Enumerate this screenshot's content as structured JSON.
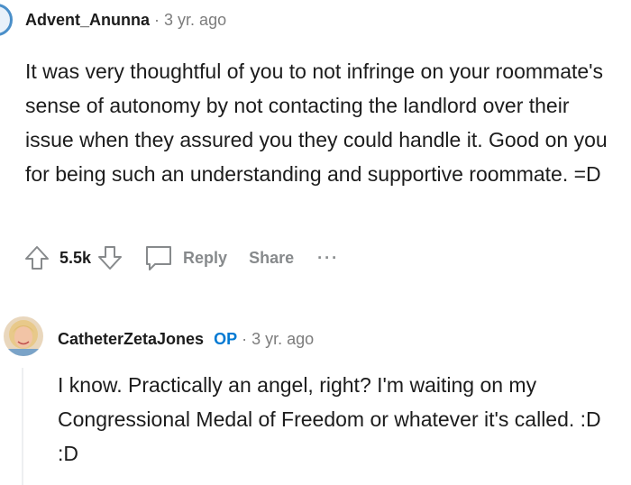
{
  "comments": [
    {
      "username": "Advent_Anunna",
      "separator": "·",
      "time": "3 yr. ago",
      "body": "It was very thoughtful of you to not infringe on your roommate's sense of autonomy by not contacting the landlord over their issue when they assured you they could handle it. Good on you for being such an understanding and supportive roommate. =D",
      "score": "5.5k",
      "reply_label": "Reply",
      "share_label": "Share",
      "more_label": "···"
    },
    {
      "username": "CatheterZetaJones",
      "op_badge": "OP",
      "separator": "·",
      "time": "3 yr. ago",
      "body": "I know. Practically an angel, right? I'm waiting on my Congressional Medal of Freedom or whatever it's called. :D :D"
    }
  ],
  "colors": {
    "text": "#1c1c1c",
    "muted": "#878a8c",
    "op_blue": "#0079d3",
    "thread_line": "#edeff1"
  },
  "icons": [
    "upvote-icon",
    "downvote-icon",
    "comment-bubble-icon",
    "more-icon",
    "avatar"
  ]
}
